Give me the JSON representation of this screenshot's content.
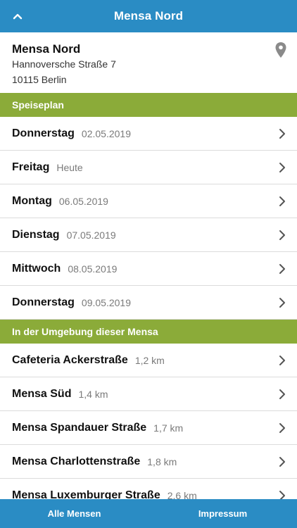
{
  "header": {
    "title": "Mensa Nord",
    "back_icon": "chevron-up-icon"
  },
  "location": {
    "name": "Mensa Nord",
    "street": "Hannoversche Straße 7",
    "city": "10115 Berlin",
    "icon": "map-pin-icon"
  },
  "menu_section": {
    "title": "Speiseplan",
    "days": [
      {
        "day": "Donnerstag",
        "date": "02.05.2019"
      },
      {
        "day": "Freitag",
        "date": "Heute"
      },
      {
        "day": "Montag",
        "date": "06.05.2019"
      },
      {
        "day": "Dienstag",
        "date": "07.05.2019"
      },
      {
        "day": "Mittwoch",
        "date": "08.05.2019"
      },
      {
        "day": "Donnerstag",
        "date": "09.05.2019"
      }
    ]
  },
  "nearby_section": {
    "title": "In der Umgebung dieser Mensa",
    "places": [
      {
        "name": "Cafeteria Ackerstraße",
        "distance": "1,2 km"
      },
      {
        "name": "Mensa Süd",
        "distance": "1,4 km"
      },
      {
        "name": "Mensa Spandauer Straße",
        "distance": "1,7 km"
      },
      {
        "name": "Mensa Charlottenstraße",
        "distance": "1,8 km"
      },
      {
        "name": "Mensa Luxemburger Straße",
        "distance": "2,6 km"
      }
    ]
  },
  "tabbar": {
    "left": "Alle Mensen",
    "right": "Impressum"
  },
  "colors": {
    "header": "#2a8cc4",
    "section": "#8bab39"
  }
}
